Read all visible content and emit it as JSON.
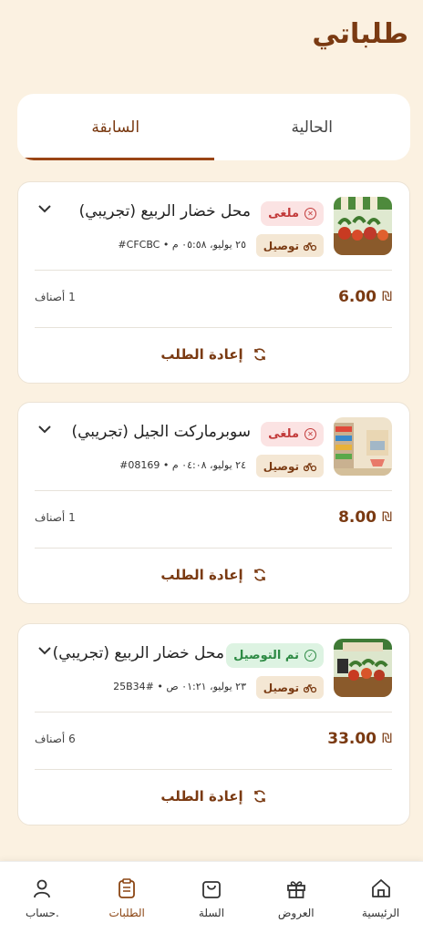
{
  "page": {
    "title": "طلباتي"
  },
  "tabs": {
    "current": "الحالية",
    "previous": "السابقة"
  },
  "orders": [
    {
      "store": "محل خضار الربيع (تجريبي)",
      "status": "ملغى",
      "delivery": "توصيل",
      "meta": "٢٥ يوليو، ٠٥:٥٨ م • CFCBC#",
      "items": "1 أصناف",
      "price": "6.00",
      "currency": "₪",
      "reorder": "إعادة الطلب"
    },
    {
      "store": "سوبرماركت الجيل (تجريبي)",
      "status": "ملغى",
      "delivery": "توصيل",
      "meta": "٢٤ يوليو، ٠٤:٠٨ م • 08169#",
      "items": "1 أصناف",
      "price": "8.00",
      "currency": "₪",
      "reorder": "إعادة الطلب"
    },
    {
      "store": "محل خضار الربيع (تجريبي)",
      "status": "تم التوصيل",
      "delivery": "توصيل",
      "meta": "٢٣ يوليو، ٠١:٢١ ص • 25B34#",
      "items": "6 أصناف",
      "price": "33.00",
      "currency": "₪",
      "reorder": "إعادة الطلب"
    }
  ],
  "nav": {
    "home": "الرئيسية",
    "offers": "العروض",
    "cart": "السلة",
    "orders": "الطلبات",
    "account": "حساب."
  }
}
